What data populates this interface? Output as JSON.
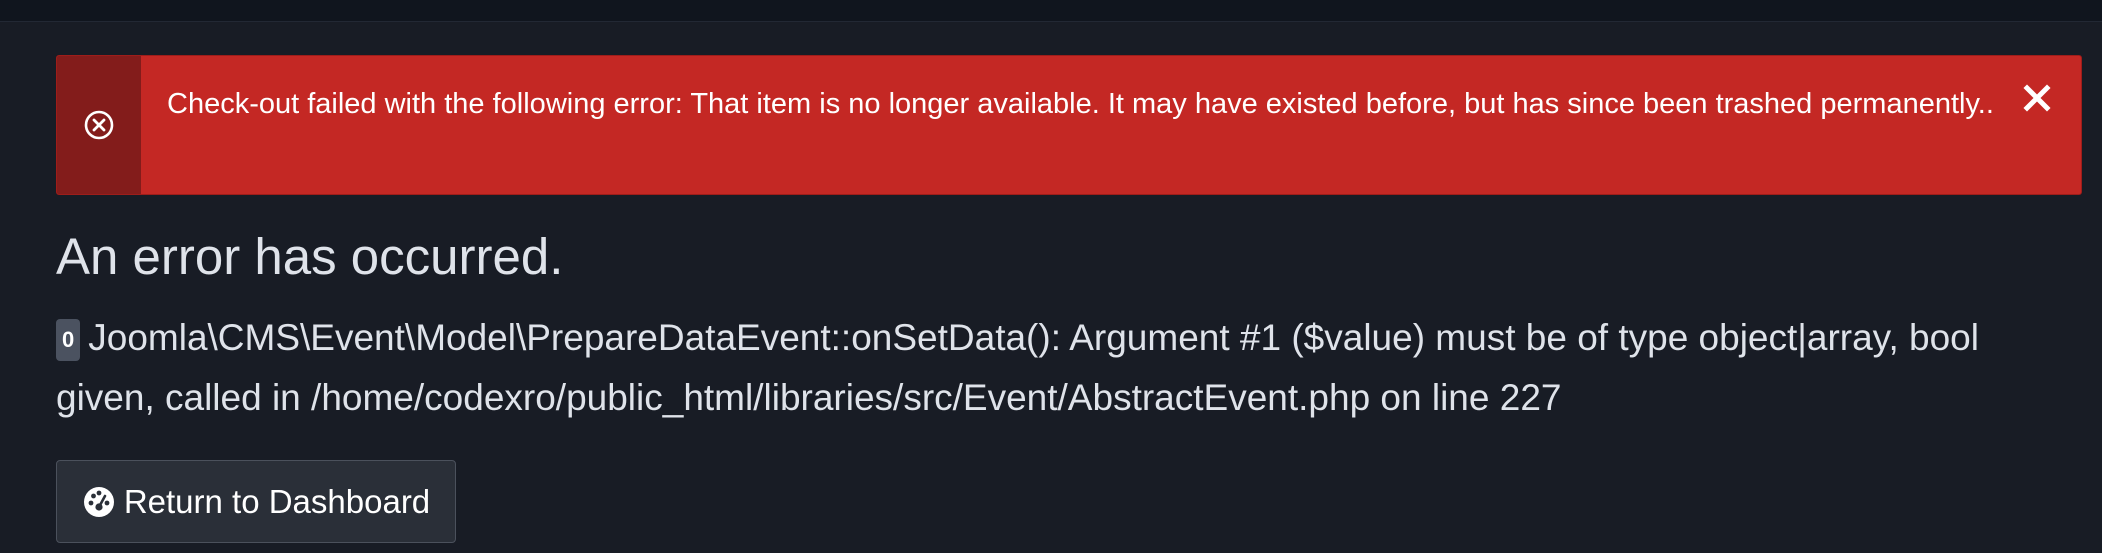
{
  "alert": {
    "icon": "circle-x-icon",
    "message": "Check-out failed with the following error: That item is no longer available. It may have existed before, but has since been trashed permanently..",
    "close_icon": "close-x-icon",
    "color": "#c42824"
  },
  "error": {
    "heading": "An error has occurred.",
    "code": "0",
    "detail": "Joomla\\CMS\\Event\\Model\\PrepareDataEvent::onSetData(): Argument #1 ($value) must be of type object|array, bool given, called in /home/codexro/public_html/libraries/src/Event/AbstractEvent.php on line 227"
  },
  "dashboard_button": {
    "icon": "gauge-icon",
    "label": "Return to Dashboard"
  }
}
